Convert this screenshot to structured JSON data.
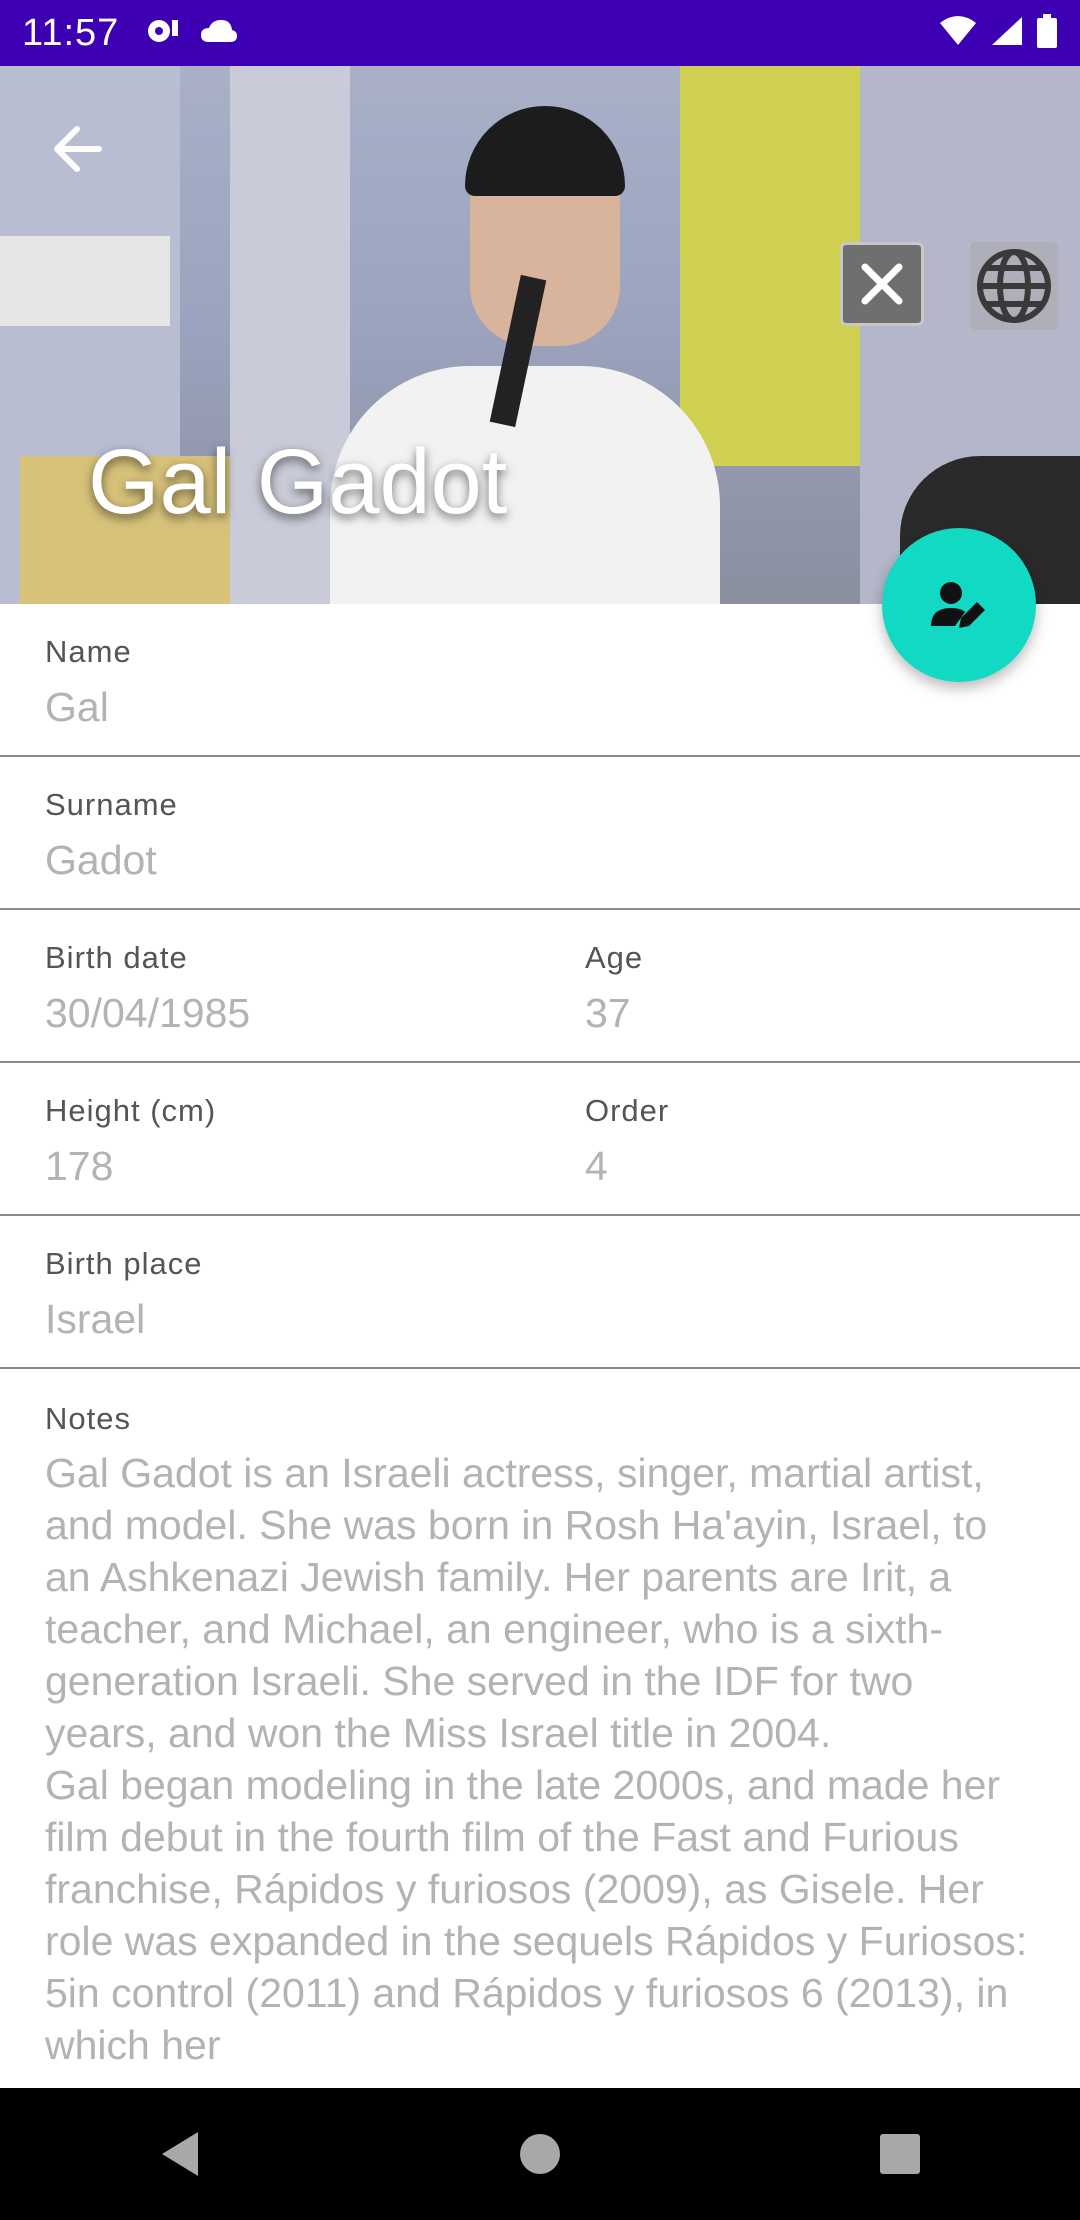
{
  "status_bar": {
    "time": "11:57",
    "icons": [
      "media-icon",
      "cloud-icon",
      "wifi-icon",
      "signal-icon",
      "battery-icon"
    ]
  },
  "header": {
    "title": "Gal Gadot",
    "back_icon": "arrow-back-icon",
    "close_icon": "close-icon",
    "web_icon": "globe-icon"
  },
  "fab": {
    "icon": "edit-person-icon",
    "color": "#11d9c4"
  },
  "fields": {
    "name": {
      "label": "Name",
      "value": "Gal"
    },
    "surname": {
      "label": "Surname",
      "value": "Gadot"
    },
    "birth_date": {
      "label": "Birth date",
      "value": "30/04/1985"
    },
    "age": {
      "label": "Age",
      "value": "37"
    },
    "height": {
      "label": "Height (cm)",
      "value": "178"
    },
    "order": {
      "label": "Order",
      "value": "4"
    },
    "birth_place": {
      "label": "Birth place",
      "value": "Israel"
    },
    "notes": {
      "label": "Notes",
      "value": "Gal Gadot is an Israeli actress, singer, martial artist, and model. She was born in Rosh Ha'ayin, Israel, to an Ashkenazi Jewish family. Her parents are Irit, a teacher, and Michael, an engineer, who is a sixth-generation Israeli. She served in the IDF for two years, and won the Miss Israel title in 2004.\nGal began modeling in the late 2000s, and made her film debut in the fourth film of the Fast and Furious franchise, Rápidos y furiosos (2009), as Gisele. Her role was expanded in the sequels Rápidos y Furiosos: 5in control (2011) and Rápidos y furiosos 6 (2013), in which her"
    }
  },
  "colors": {
    "status_bar": "#3d00b3",
    "label": "#555555",
    "value": "#b3b3b3",
    "divider": "#8a8a8a"
  }
}
